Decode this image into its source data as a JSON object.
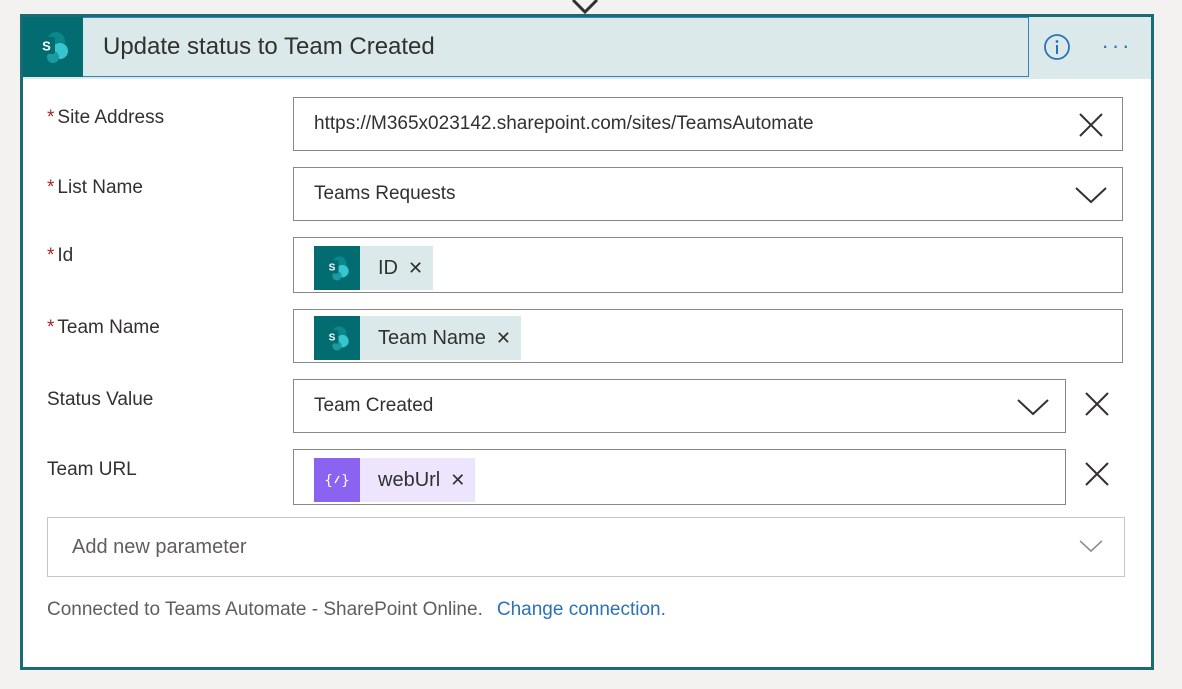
{
  "action": {
    "title": "Update status to Team Created",
    "icons": {
      "header": "sharepoint-icon",
      "info": "info-icon",
      "more": "more-options-icon"
    }
  },
  "fields": {
    "site_address": {
      "label": "Site Address",
      "required": "*",
      "value": "https://M365x023142.sharepoint.com/sites/TeamsAutomate"
    },
    "list_name": {
      "label": "List Name",
      "required": "*",
      "value": "Teams Requests"
    },
    "id": {
      "label": "Id",
      "required": "*",
      "token": "ID"
    },
    "team_name": {
      "label": "Team Name",
      "required": "*",
      "token": "Team Name"
    },
    "status_value": {
      "label": "Status Value",
      "value": "Team Created"
    },
    "team_url": {
      "label": "Team URL",
      "token": "webUrl"
    }
  },
  "add_parameter": {
    "placeholder": "Add new parameter"
  },
  "footer": {
    "connection_text": "Connected to Teams Automate - SharePoint Online.",
    "change_link": "Change connection."
  },
  "colors": {
    "border": "#1b6b73",
    "header_bg": "#dbe9ea",
    "sharepoint": "#036c70",
    "expression": "#8a63f1",
    "link": "#2b72b8",
    "required": "#a4262c"
  }
}
